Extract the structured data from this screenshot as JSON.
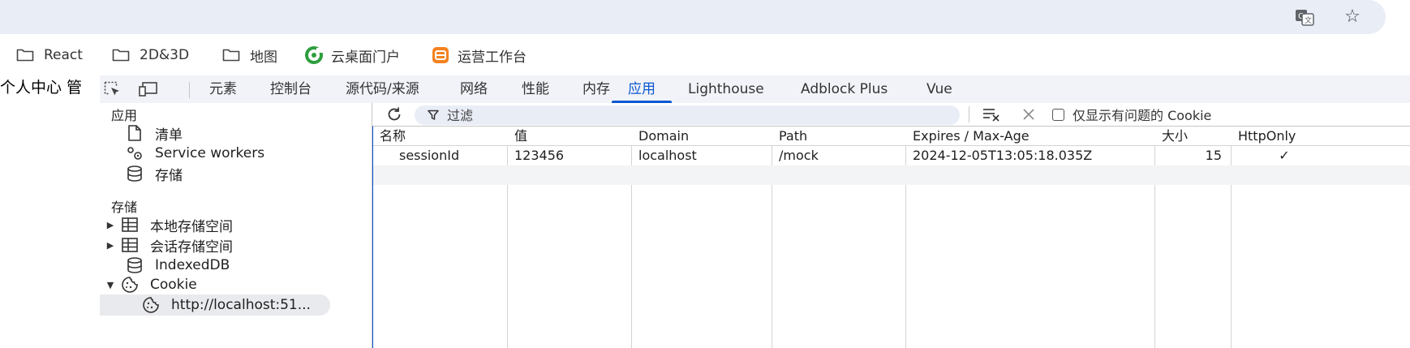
{
  "browser": {
    "bookmarks": [
      {
        "label": "React",
        "icon": "folder-icon"
      },
      {
        "label": "2D&3D",
        "icon": "folder-icon"
      },
      {
        "label": "地图",
        "icon": "folder-icon"
      },
      {
        "label": "云桌面门户",
        "icon": "cloud-desktop-icon"
      },
      {
        "label": "运营工作台",
        "icon": "ops-console-icon"
      }
    ]
  },
  "page": {
    "text": "个人中心 管"
  },
  "devtools": {
    "tabs": [
      "元素",
      "控制台",
      "源代码/来源",
      "网络",
      "性能",
      "内存",
      "应用",
      "Lighthouse",
      "Adblock Plus",
      "Vue"
    ],
    "active_tab": "应用",
    "sidebar": {
      "app_section": "应用",
      "app_items": [
        "清单",
        "Service workers",
        "存储"
      ],
      "storage_section": "存储",
      "storage_items": [
        "本地存储空间",
        "会话存储空间",
        "IndexedDB",
        "Cookie"
      ],
      "cookie_child": "http://localhost:51..."
    },
    "toolbar": {
      "filter_placeholder": "过滤",
      "only_issues_label": "仅显示有问题的 Cookie"
    },
    "table": {
      "columns": [
        "名称",
        "值",
        "Domain",
        "Path",
        "Expires / Max-Age",
        "大小",
        "HttpOnly"
      ],
      "rows": [
        {
          "name": "sessionId",
          "value": "123456",
          "domain": "localhost",
          "path": "/mock",
          "expires": "2024-12-05T13:05:18.035Z",
          "size": "15",
          "httponly": "✓"
        }
      ]
    }
  },
  "colors": {
    "accent": "#0b57d0",
    "omnibox": "#e9edf6",
    "tabbar": "#f1f3f8"
  }
}
